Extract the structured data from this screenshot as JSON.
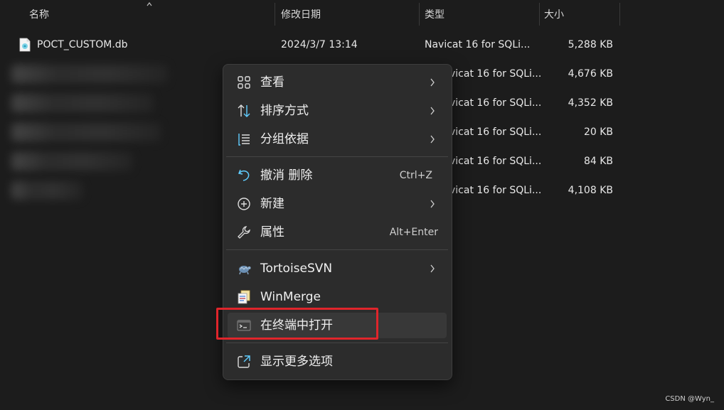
{
  "header": {
    "name": "名称",
    "modified": "修改日期",
    "type": "类型",
    "size": "大小"
  },
  "files": [
    {
      "name": "POCT_CUSTOM.db",
      "modified": "2024/3/7 13:14",
      "type": "Navicat 16 for SQLi...",
      "size": "5,288 KB",
      "blurred": false
    },
    {
      "name": "",
      "modified": "",
      "type": "vicat 16 for SQLi...",
      "size": "4,676 KB",
      "blurred": true
    },
    {
      "name": "",
      "modified": "",
      "type": "vicat 16 for SQLi...",
      "size": "4,352 KB",
      "blurred": true
    },
    {
      "name": "",
      "modified": "",
      "type": "vicat 16 for SQLi...",
      "size": "20 KB",
      "blurred": true
    },
    {
      "name": "",
      "modified": "",
      "type": "vicat 16 for SQLi...",
      "size": "84 KB",
      "blurred": true
    },
    {
      "name": "",
      "modified": "",
      "type": "vicat 16 for SQLi...",
      "size": "4,108 KB",
      "blurred": true
    }
  ],
  "context_menu": {
    "view": {
      "label": "查看",
      "icon": "grid-icon"
    },
    "sort": {
      "label": "排序方式",
      "icon": "sort-icon"
    },
    "group": {
      "label": "分组依据",
      "icon": "group-list-icon"
    },
    "undo": {
      "label": "撤消 删除",
      "shortcut": "Ctrl+Z",
      "icon": "undo-icon"
    },
    "new": {
      "label": "新建",
      "icon": "plus-circle-icon"
    },
    "properties": {
      "label": "属性",
      "shortcut": "Alt+Enter",
      "icon": "wrench-icon"
    },
    "tortoise": {
      "label": "TortoiseSVN",
      "icon": "tortoise-icon"
    },
    "winmerge": {
      "label": "WinMerge",
      "icon": "winmerge-icon"
    },
    "terminal": {
      "label": "在终端中打开",
      "icon": "terminal-icon"
    },
    "more": {
      "label": "显示更多选项",
      "icon": "share-icon"
    }
  },
  "watermark": "CSDN @Wyn_",
  "colors": {
    "accent": "#60cdff",
    "highlight_border": "#e0252b"
  }
}
